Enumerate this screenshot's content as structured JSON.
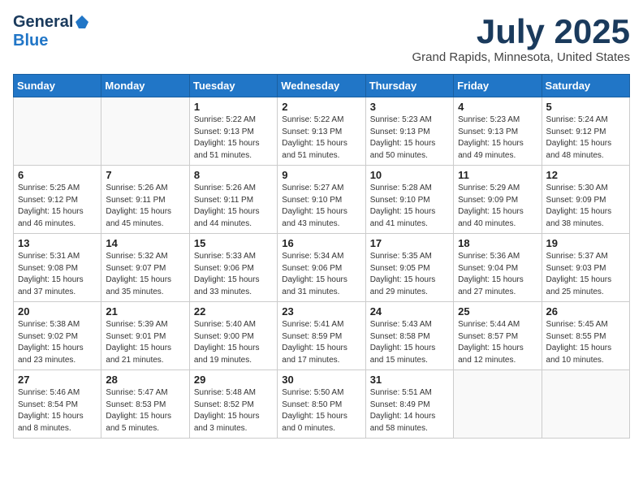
{
  "header": {
    "logo_general": "General",
    "logo_blue": "Blue",
    "title": "July 2025",
    "location": "Grand Rapids, Minnesota, United States"
  },
  "weekdays": [
    "Sunday",
    "Monday",
    "Tuesday",
    "Wednesday",
    "Thursday",
    "Friday",
    "Saturday"
  ],
  "weeks": [
    [
      {
        "day": "",
        "info": ""
      },
      {
        "day": "",
        "info": ""
      },
      {
        "day": "1",
        "info": "Sunrise: 5:22 AM\nSunset: 9:13 PM\nDaylight: 15 hours\nand 51 minutes."
      },
      {
        "day": "2",
        "info": "Sunrise: 5:22 AM\nSunset: 9:13 PM\nDaylight: 15 hours\nand 51 minutes."
      },
      {
        "day": "3",
        "info": "Sunrise: 5:23 AM\nSunset: 9:13 PM\nDaylight: 15 hours\nand 50 minutes."
      },
      {
        "day": "4",
        "info": "Sunrise: 5:23 AM\nSunset: 9:13 PM\nDaylight: 15 hours\nand 49 minutes."
      },
      {
        "day": "5",
        "info": "Sunrise: 5:24 AM\nSunset: 9:12 PM\nDaylight: 15 hours\nand 48 minutes."
      }
    ],
    [
      {
        "day": "6",
        "info": "Sunrise: 5:25 AM\nSunset: 9:12 PM\nDaylight: 15 hours\nand 46 minutes."
      },
      {
        "day": "7",
        "info": "Sunrise: 5:26 AM\nSunset: 9:11 PM\nDaylight: 15 hours\nand 45 minutes."
      },
      {
        "day": "8",
        "info": "Sunrise: 5:26 AM\nSunset: 9:11 PM\nDaylight: 15 hours\nand 44 minutes."
      },
      {
        "day": "9",
        "info": "Sunrise: 5:27 AM\nSunset: 9:10 PM\nDaylight: 15 hours\nand 43 minutes."
      },
      {
        "day": "10",
        "info": "Sunrise: 5:28 AM\nSunset: 9:10 PM\nDaylight: 15 hours\nand 41 minutes."
      },
      {
        "day": "11",
        "info": "Sunrise: 5:29 AM\nSunset: 9:09 PM\nDaylight: 15 hours\nand 40 minutes."
      },
      {
        "day": "12",
        "info": "Sunrise: 5:30 AM\nSunset: 9:09 PM\nDaylight: 15 hours\nand 38 minutes."
      }
    ],
    [
      {
        "day": "13",
        "info": "Sunrise: 5:31 AM\nSunset: 9:08 PM\nDaylight: 15 hours\nand 37 minutes."
      },
      {
        "day": "14",
        "info": "Sunrise: 5:32 AM\nSunset: 9:07 PM\nDaylight: 15 hours\nand 35 minutes."
      },
      {
        "day": "15",
        "info": "Sunrise: 5:33 AM\nSunset: 9:06 PM\nDaylight: 15 hours\nand 33 minutes."
      },
      {
        "day": "16",
        "info": "Sunrise: 5:34 AM\nSunset: 9:06 PM\nDaylight: 15 hours\nand 31 minutes."
      },
      {
        "day": "17",
        "info": "Sunrise: 5:35 AM\nSunset: 9:05 PM\nDaylight: 15 hours\nand 29 minutes."
      },
      {
        "day": "18",
        "info": "Sunrise: 5:36 AM\nSunset: 9:04 PM\nDaylight: 15 hours\nand 27 minutes."
      },
      {
        "day": "19",
        "info": "Sunrise: 5:37 AM\nSunset: 9:03 PM\nDaylight: 15 hours\nand 25 minutes."
      }
    ],
    [
      {
        "day": "20",
        "info": "Sunrise: 5:38 AM\nSunset: 9:02 PM\nDaylight: 15 hours\nand 23 minutes."
      },
      {
        "day": "21",
        "info": "Sunrise: 5:39 AM\nSunset: 9:01 PM\nDaylight: 15 hours\nand 21 minutes."
      },
      {
        "day": "22",
        "info": "Sunrise: 5:40 AM\nSunset: 9:00 PM\nDaylight: 15 hours\nand 19 minutes."
      },
      {
        "day": "23",
        "info": "Sunrise: 5:41 AM\nSunset: 8:59 PM\nDaylight: 15 hours\nand 17 minutes."
      },
      {
        "day": "24",
        "info": "Sunrise: 5:43 AM\nSunset: 8:58 PM\nDaylight: 15 hours\nand 15 minutes."
      },
      {
        "day": "25",
        "info": "Sunrise: 5:44 AM\nSunset: 8:57 PM\nDaylight: 15 hours\nand 12 minutes."
      },
      {
        "day": "26",
        "info": "Sunrise: 5:45 AM\nSunset: 8:55 PM\nDaylight: 15 hours\nand 10 minutes."
      }
    ],
    [
      {
        "day": "27",
        "info": "Sunrise: 5:46 AM\nSunset: 8:54 PM\nDaylight: 15 hours\nand 8 minutes."
      },
      {
        "day": "28",
        "info": "Sunrise: 5:47 AM\nSunset: 8:53 PM\nDaylight: 15 hours\nand 5 minutes."
      },
      {
        "day": "29",
        "info": "Sunrise: 5:48 AM\nSunset: 8:52 PM\nDaylight: 15 hours\nand 3 minutes."
      },
      {
        "day": "30",
        "info": "Sunrise: 5:50 AM\nSunset: 8:50 PM\nDaylight: 15 hours\nand 0 minutes."
      },
      {
        "day": "31",
        "info": "Sunrise: 5:51 AM\nSunset: 8:49 PM\nDaylight: 14 hours\nand 58 minutes."
      },
      {
        "day": "",
        "info": ""
      },
      {
        "day": "",
        "info": ""
      }
    ]
  ]
}
